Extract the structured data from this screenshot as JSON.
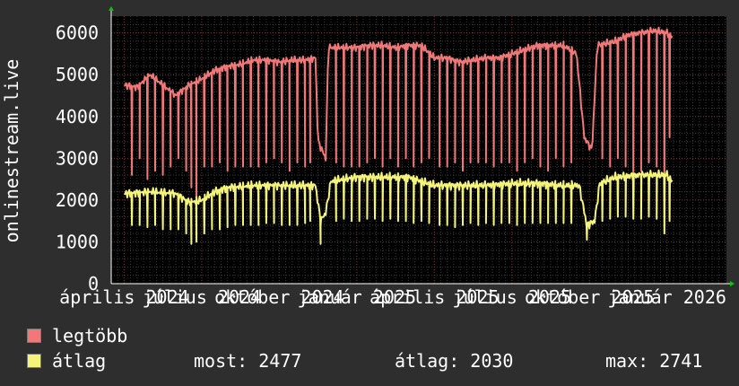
{
  "colors": {
    "background": "#2e2e2e",
    "plot_bg": "#000000",
    "grid_minor": "#3a3a3a",
    "grid_major": "#7a2a2a",
    "axis": "#ffffff",
    "max_series": "#f07878",
    "avg_series": "#f4f47a",
    "arrow": "#00cc00"
  },
  "chart_data": {
    "type": "line",
    "ylabel": "onlinestream.live",
    "ylim": [
      0,
      6400
    ],
    "y_ticks": [
      0,
      1000,
      2000,
      3000,
      4000,
      5000,
      6000
    ],
    "x_tick_labels": [
      "április",
      "július",
      "október",
      "január",
      "április",
      "július",
      "október",
      "január"
    ],
    "x_year_labels": [
      "2024",
      "2024",
      "2024",
      "2025",
      "2025",
      "2025",
      "2025",
      "2026"
    ],
    "x_month_positions": [
      0,
      3,
      6,
      9,
      12,
      15,
      18,
      21
    ],
    "x_range_months": [
      -0.5,
      23.3
    ],
    "grid": true,
    "series": [
      {
        "name": "legtöbb",
        "color": "#f07878",
        "baseline": [
          [
            0,
            4750
          ],
          [
            0.5,
            4700
          ],
          [
            1,
            5000
          ],
          [
            1.5,
            4750
          ],
          [
            2,
            4500
          ],
          [
            2.5,
            4750
          ],
          [
            3,
            4900
          ],
          [
            3.5,
            5100
          ],
          [
            4,
            5200
          ],
          [
            4.5,
            5250
          ],
          [
            5,
            5350
          ],
          [
            5.5,
            5350
          ],
          [
            6,
            5300
          ],
          [
            6.5,
            5350
          ],
          [
            7,
            5350
          ],
          [
            7.4,
            5400
          ],
          [
            7.5,
            3400
          ],
          [
            7.8,
            3000
          ],
          [
            7.9,
            5650
          ],
          [
            8.5,
            5650
          ],
          [
            9,
            5650
          ],
          [
            9.5,
            5700
          ],
          [
            10,
            5700
          ],
          [
            10.5,
            5650
          ],
          [
            11,
            5700
          ],
          [
            11.5,
            5700
          ],
          [
            12,
            5400
          ],
          [
            12.5,
            5400
          ],
          [
            13,
            5300
          ],
          [
            13.5,
            5350
          ],
          [
            14,
            5400
          ],
          [
            14.5,
            5400
          ],
          [
            15,
            5500
          ],
          [
            15.5,
            5600
          ],
          [
            16,
            5700
          ],
          [
            16.5,
            5700
          ],
          [
            17,
            5700
          ],
          [
            17.5,
            5500
          ],
          [
            17.8,
            3500
          ],
          [
            18.1,
            3200
          ],
          [
            18.3,
            5700
          ],
          [
            19,
            5800
          ],
          [
            19.5,
            5950
          ],
          [
            20,
            6000
          ],
          [
            20.5,
            6050
          ],
          [
            21,
            6000
          ],
          [
            21.2,
            5900
          ]
        ],
        "dips": [
          [
            0.3,
            2600
          ],
          [
            0.6,
            3000
          ],
          [
            0.9,
            2500
          ],
          [
            1.2,
            2700
          ],
          [
            1.5,
            2600
          ],
          [
            1.8,
            2800
          ],
          [
            2.1,
            3000
          ],
          [
            2.4,
            2700
          ],
          [
            2.6,
            2300
          ],
          [
            2.8,
            2000
          ],
          [
            3.1,
            2800
          ],
          [
            3.4,
            2800
          ],
          [
            3.7,
            2900
          ],
          [
            4.0,
            2700
          ],
          [
            4.3,
            2800
          ],
          [
            4.6,
            2800
          ],
          [
            4.9,
            2800
          ],
          [
            5.2,
            2800
          ],
          [
            5.5,
            2900
          ],
          [
            5.8,
            3000
          ],
          [
            6.1,
            2900
          ],
          [
            6.4,
            2700
          ],
          [
            6.7,
            2900
          ],
          [
            7.0,
            2800
          ],
          [
            7.2,
            2900
          ],
          [
            8.2,
            2900
          ],
          [
            8.5,
            2800
          ],
          [
            8.8,
            2800
          ],
          [
            9.1,
            2800
          ],
          [
            9.4,
            2900
          ],
          [
            9.7,
            3000
          ],
          [
            10.0,
            2800
          ],
          [
            10.3,
            3000
          ],
          [
            10.6,
            2800
          ],
          [
            10.9,
            3000
          ],
          [
            11.2,
            2800
          ],
          [
            11.5,
            2900
          ],
          [
            11.8,
            3000
          ],
          [
            12.2,
            2800
          ],
          [
            12.5,
            2800
          ],
          [
            12.8,
            2900
          ],
          [
            13.1,
            2700
          ],
          [
            13.4,
            2900
          ],
          [
            13.7,
            2900
          ],
          [
            14.0,
            2900
          ],
          [
            14.3,
            2800
          ],
          [
            14.6,
            2900
          ],
          [
            14.9,
            2900
          ],
          [
            15.2,
            2700
          ],
          [
            15.5,
            2900
          ],
          [
            15.8,
            3000
          ],
          [
            16.1,
            2800
          ],
          [
            16.4,
            2700
          ],
          [
            16.7,
            3000
          ],
          [
            17.0,
            2800
          ],
          [
            17.3,
            2900
          ],
          [
            18.5,
            3000
          ],
          [
            18.8,
            2800
          ],
          [
            19.1,
            3000
          ],
          [
            19.4,
            2800
          ],
          [
            19.7,
            2600
          ],
          [
            20.0,
            2700
          ],
          [
            20.3,
            2900
          ],
          [
            20.6,
            2800
          ],
          [
            20.9,
            2200
          ],
          [
            21.1,
            3500
          ]
        ]
      },
      {
        "name": "átlag",
        "color": "#f4f47a",
        "baseline": [
          [
            0,
            2150
          ],
          [
            1,
            2200
          ],
          [
            2,
            2150
          ],
          [
            2.5,
            1950
          ],
          [
            3,
            2000
          ],
          [
            3.5,
            2200
          ],
          [
            4,
            2300
          ],
          [
            5,
            2350
          ],
          [
            6,
            2350
          ],
          [
            7,
            2350
          ],
          [
            7.4,
            2350
          ],
          [
            7.6,
            1500
          ],
          [
            7.8,
            1700
          ],
          [
            8.0,
            2450
          ],
          [
            9,
            2550
          ],
          [
            10,
            2550
          ],
          [
            11,
            2550
          ],
          [
            12,
            2350
          ],
          [
            13,
            2350
          ],
          [
            14,
            2350
          ],
          [
            15,
            2400
          ],
          [
            16,
            2400
          ],
          [
            17,
            2350
          ],
          [
            17.6,
            2350
          ],
          [
            17.9,
            1400
          ],
          [
            18.2,
            1500
          ],
          [
            18.4,
            2400
          ],
          [
            19,
            2550
          ],
          [
            20,
            2600
          ],
          [
            21,
            2600
          ],
          [
            21.2,
            2450
          ]
        ],
        "dips": [
          [
            0.3,
            1400
          ],
          [
            0.6,
            1400
          ],
          [
            0.9,
            1350
          ],
          [
            1.2,
            1400
          ],
          [
            1.5,
            1300
          ],
          [
            1.8,
            1300
          ],
          [
            2.1,
            1300
          ],
          [
            2.4,
            1200
          ],
          [
            2.6,
            950
          ],
          [
            2.8,
            1000
          ],
          [
            3.1,
            1200
          ],
          [
            3.4,
            1300
          ],
          [
            3.7,
            1300
          ],
          [
            4.0,
            1350
          ],
          [
            4.3,
            1400
          ],
          [
            4.6,
            1400
          ],
          [
            4.9,
            1400
          ],
          [
            5.2,
            1400
          ],
          [
            5.5,
            1450
          ],
          [
            5.8,
            1450
          ],
          [
            6.1,
            1400
          ],
          [
            6.4,
            1400
          ],
          [
            6.7,
            1400
          ],
          [
            7.0,
            1450
          ],
          [
            7.2,
            1500
          ],
          [
            7.6,
            950
          ],
          [
            8.2,
            1500
          ],
          [
            8.5,
            1550
          ],
          [
            8.8,
            1500
          ],
          [
            9.1,
            1500
          ],
          [
            9.4,
            1550
          ],
          [
            9.7,
            1550
          ],
          [
            10.0,
            1500
          ],
          [
            10.3,
            1550
          ],
          [
            10.6,
            1500
          ],
          [
            10.9,
            1500
          ],
          [
            11.2,
            1450
          ],
          [
            11.5,
            1500
          ],
          [
            11.8,
            1450
          ],
          [
            12.2,
            1400
          ],
          [
            12.5,
            1400
          ],
          [
            12.8,
            1350
          ],
          [
            13.1,
            1400
          ],
          [
            13.4,
            1450
          ],
          [
            13.7,
            1400
          ],
          [
            14.0,
            1450
          ],
          [
            14.3,
            1400
          ],
          [
            14.6,
            1450
          ],
          [
            14.9,
            1450
          ],
          [
            15.2,
            1400
          ],
          [
            15.5,
            1450
          ],
          [
            15.8,
            1450
          ],
          [
            16.1,
            1450
          ],
          [
            16.4,
            1450
          ],
          [
            16.7,
            1450
          ],
          [
            17.0,
            1450
          ],
          [
            17.3,
            1450
          ],
          [
            17.9,
            1050
          ],
          [
            18.5,
            1500
          ],
          [
            18.8,
            1550
          ],
          [
            19.1,
            1600
          ],
          [
            19.4,
            1600
          ],
          [
            19.7,
            1550
          ],
          [
            20.0,
            1550
          ],
          [
            20.3,
            1600
          ],
          [
            20.6,
            1550
          ],
          [
            20.9,
            1200
          ],
          [
            21.1,
            1500
          ]
        ]
      }
    ]
  },
  "legend": {
    "max_label": "legtöbb",
    "avg_label": "átlag",
    "now_label": "most: 2477",
    "avg_stat": "átlag: 2030",
    "max_stat": "max: 2741"
  }
}
